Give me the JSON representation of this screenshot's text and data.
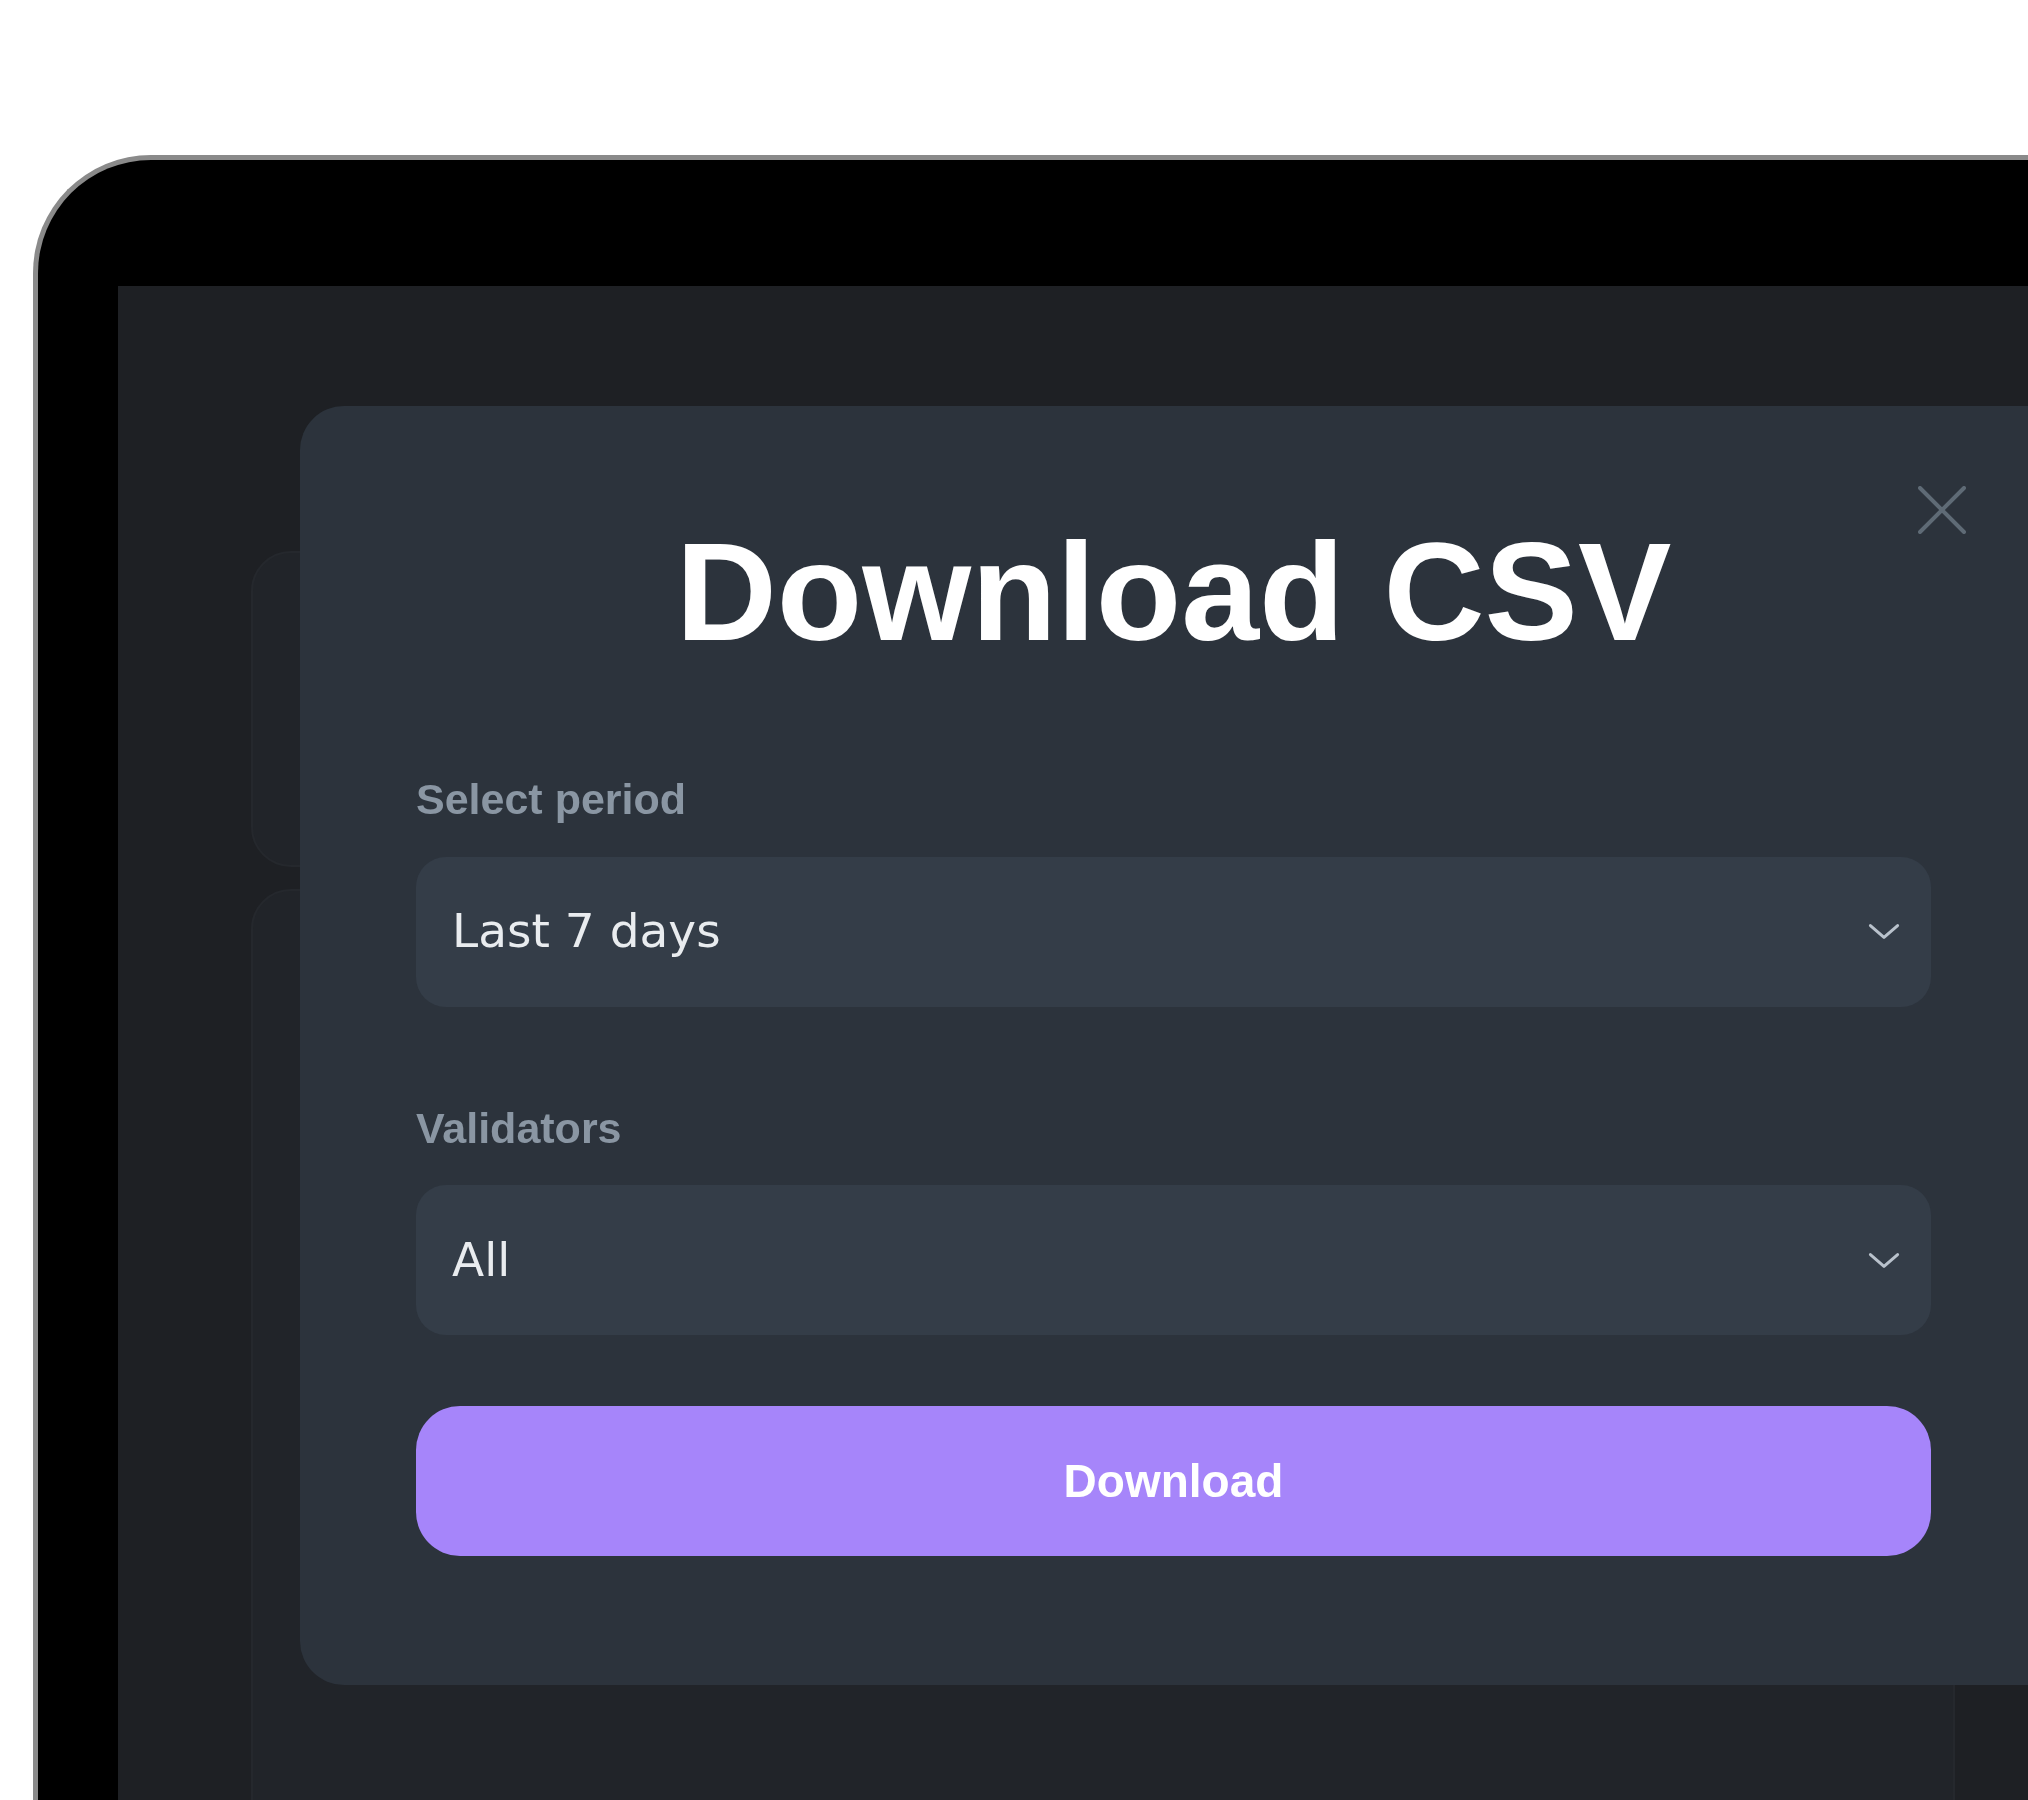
{
  "dialog": {
    "title": "Download CSV",
    "fields": [
      {
        "label": "Select period",
        "value": "Last 7 days"
      },
      {
        "label": "Validators",
        "value": "All"
      }
    ],
    "button": "Download"
  }
}
